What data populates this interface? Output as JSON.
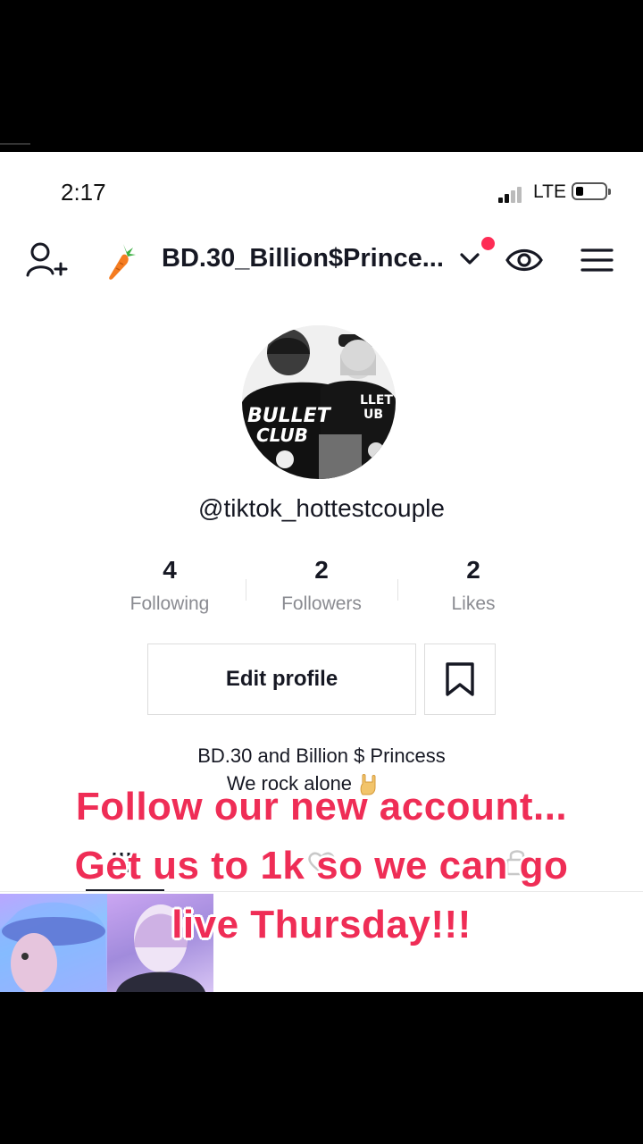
{
  "status_bar": {
    "time": "2:17",
    "network": "LTE"
  },
  "header": {
    "username": "BD.30_Billion$Prince...",
    "icons": [
      "add-user-icon",
      "carrot-icon",
      "chevron-down-icon",
      "eye-icon",
      "menu-icon"
    ]
  },
  "profile": {
    "handle": "@tiktok_hottestcouple",
    "stats": [
      {
        "count": "4",
        "label": "Following"
      },
      {
        "count": "2",
        "label": "Followers"
      },
      {
        "count": "2",
        "label": "Likes"
      }
    ],
    "edit_button": "Edit profile",
    "bio_name": "BD.30 and Billion $ Princess",
    "bio_line": "We rock alone"
  },
  "caption_overlay": {
    "line1": "Follow our new account...",
    "line2": "Get us to 1k so we can go",
    "line3": "live Thursday!!!"
  },
  "colors": {
    "accent": "#fe2c55",
    "caption": "#ef2d56",
    "text": "#161823",
    "muted": "#8a8b91"
  }
}
